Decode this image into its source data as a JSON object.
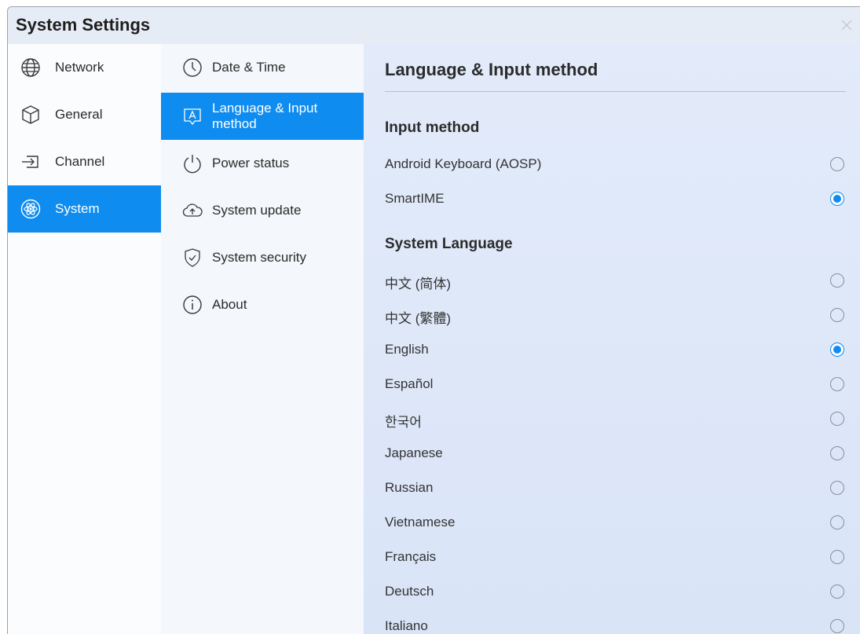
{
  "window": {
    "title": "System Settings"
  },
  "categories": [
    {
      "label": "Network",
      "icon": "globe-icon",
      "active": false
    },
    {
      "label": "General",
      "icon": "cube-icon",
      "active": false
    },
    {
      "label": "Channel",
      "icon": "input-arrow-icon",
      "active": false
    },
    {
      "label": "System",
      "icon": "atom-icon",
      "active": true
    }
  ],
  "subnav": [
    {
      "label": "Date & Time",
      "icon": "clock-icon",
      "active": false
    },
    {
      "label": "Language & Input method",
      "icon": "keyboard-a-icon",
      "active": true
    },
    {
      "label": "Power status",
      "icon": "power-icon",
      "active": false
    },
    {
      "label": "System update",
      "icon": "cloud-upload-icon",
      "active": false
    },
    {
      "label": "System security",
      "icon": "shield-check-icon",
      "active": false
    },
    {
      "label": "About",
      "icon": "info-icon",
      "active": false
    }
  ],
  "content": {
    "heading": "Language & Input method",
    "input_method": {
      "title": "Input method",
      "options": [
        {
          "label": "Android Keyboard (AOSP)",
          "checked": false
        },
        {
          "label": "SmartIME",
          "checked": true
        }
      ]
    },
    "system_language": {
      "title": "System Language",
      "options": [
        {
          "label": "中文 (简体)",
          "checked": false
        },
        {
          "label": "中文 (繁體)",
          "checked": false
        },
        {
          "label": "English",
          "checked": true
        },
        {
          "label": "Español",
          "checked": false
        },
        {
          "label": "한국어",
          "checked": false
        },
        {
          "label": "Japanese",
          "checked": false
        },
        {
          "label": "Russian",
          "checked": false
        },
        {
          "label": "Vietnamese",
          "checked": false
        },
        {
          "label": "Français",
          "checked": false
        },
        {
          "label": "Deutsch",
          "checked": false
        },
        {
          "label": "Italiano",
          "checked": false
        }
      ]
    }
  },
  "colors": {
    "accent": "#0f8cf0",
    "titlebar": "#e6ecf5",
    "content_bg": "#dfe8f8"
  }
}
